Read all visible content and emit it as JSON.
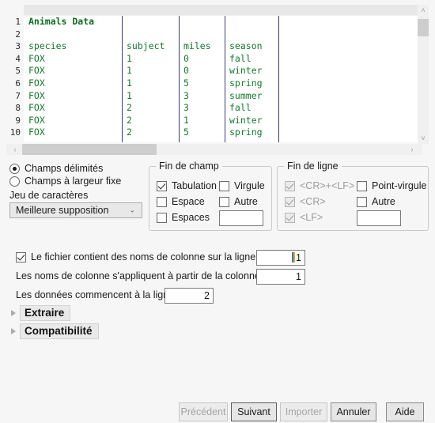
{
  "preview": {
    "columns": [
      "species",
      "subject",
      "miles",
      "season"
    ],
    "rows": [
      {
        "line": "1",
        "cells": [
          "Animals Data",
          "",
          "",
          ""
        ],
        "bold": true
      },
      {
        "line": "2",
        "cells": [
          "",
          "",
          "",
          ""
        ],
        "bold": false
      },
      {
        "line": "3",
        "cells": [
          "species",
          "subject",
          "miles",
          "season"
        ],
        "bold": false
      },
      {
        "line": "4",
        "cells": [
          "FOX",
          "1",
          "0",
          "fall"
        ],
        "bold": false
      },
      {
        "line": "5",
        "cells": [
          "FOX",
          "1",
          "0",
          "winter"
        ],
        "bold": false
      },
      {
        "line": "6",
        "cells": [
          "FOX",
          "1",
          "5",
          "spring"
        ],
        "bold": false
      },
      {
        "line": "7",
        "cells": [
          "FOX",
          "1",
          "3",
          "summer"
        ],
        "bold": false
      },
      {
        "line": "8",
        "cells": [
          "FOX",
          "2",
          "3",
          "fall"
        ],
        "bold": false
      },
      {
        "line": "9",
        "cells": [
          "FOX",
          "2",
          "1",
          "winter"
        ],
        "bold": false
      },
      {
        "line": "10",
        "cells": [
          "FOX",
          "2",
          "5",
          "spring"
        ],
        "bold": false
      }
    ],
    "scroll_up_icon": "˄",
    "scroll_down_icon": "˅",
    "scroll_left_icon": "‹",
    "scroll_right_icon": "›",
    "text_color": "#157a2e",
    "title_color": "#0d6b24",
    "separator_color": "#3a3a7a"
  },
  "field_type": {
    "delimited_label": "Champs délimités",
    "delimited_checked": true,
    "fixed_width_label": "Champs à largeur fixe",
    "fixed_width_checked": false,
    "charset_label": "Jeu de caractères",
    "charset_value": "Meilleure supposition",
    "charset_arrow": "⌄"
  },
  "field_end": {
    "title": "Fin de champ",
    "items": [
      {
        "label": "Tabulation",
        "checked": true,
        "disabled": false
      },
      {
        "label": "Virgule",
        "checked": false,
        "disabled": false
      },
      {
        "label": "Espace",
        "checked": false,
        "disabled": false
      },
      {
        "label": "Autre",
        "checked": false,
        "disabled": false
      },
      {
        "label": "Espaces",
        "checked": false,
        "disabled": false
      }
    ],
    "other_value": ""
  },
  "line_end": {
    "title": "Fin de ligne",
    "items": [
      {
        "label": "<CR>+<LF>",
        "checked": true,
        "disabled": true
      },
      {
        "label": "Point-virgule",
        "checked": false,
        "disabled": false
      },
      {
        "label": "<CR>",
        "checked": true,
        "disabled": true
      },
      {
        "label": "Autre",
        "checked": false,
        "disabled": false
      },
      {
        "label": "<LF>",
        "checked": true,
        "disabled": true
      }
    ],
    "other_value": ""
  },
  "options": {
    "header_checkbox_label": "Le fichier contient des noms de colonne sur la ligne :",
    "header_checkbox_checked": true,
    "header_line_value": "1",
    "names_from_column_label": "Les noms de colonne s'appliquent à partir de la colonne :",
    "names_from_column_value": "1",
    "data_start_label": "Les données commencent à la ligne :",
    "data_start_value": "2"
  },
  "expanders": [
    {
      "label": "Extraire",
      "expanded": false
    },
    {
      "label": "Compatibilité",
      "expanded": false
    }
  ],
  "footer": {
    "buttons": [
      {
        "label": "Précédent",
        "disabled": true,
        "default": false
      },
      {
        "label": "Suivant",
        "disabled": false,
        "default": true
      },
      {
        "label": "Importer",
        "disabled": true,
        "default": false
      },
      {
        "label": "Annuler",
        "disabled": false,
        "default": false
      },
      {
        "label": "Aide",
        "disabled": false,
        "default": false
      }
    ]
  }
}
